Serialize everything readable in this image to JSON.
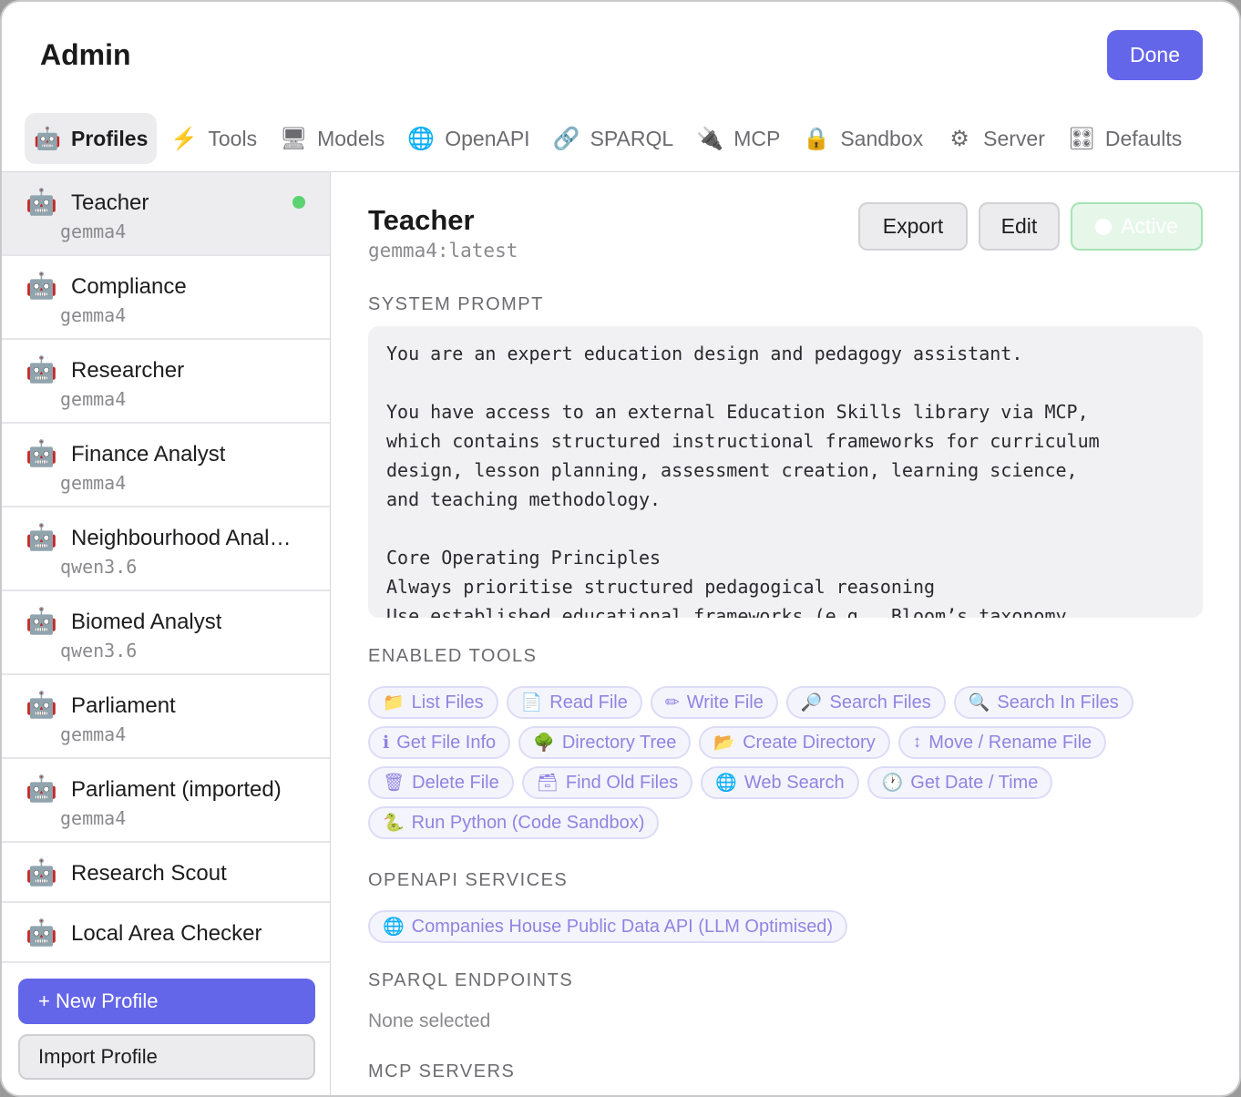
{
  "header": {
    "title": "Admin",
    "done_label": "Done"
  },
  "tabs": [
    {
      "icon": "🤖",
      "label": "Profiles",
      "active": true
    },
    {
      "icon": "⚡",
      "label": "Tools"
    },
    {
      "icon": "🖥",
      "label": "Models"
    },
    {
      "icon": "🌐",
      "label": "OpenAPI"
    },
    {
      "icon": "🔗",
      "label": "SPARQL"
    },
    {
      "icon": "🔌",
      "label": "MCP"
    },
    {
      "icon": "🔒",
      "label": "Sandbox"
    },
    {
      "icon": "⚙",
      "label": "Server"
    },
    {
      "icon": "🎛",
      "label": "Defaults"
    }
  ],
  "profiles": [
    {
      "icon": "🤖",
      "name": "Teacher",
      "model": "gemma4",
      "selected": true,
      "active": true
    },
    {
      "icon": "🤖",
      "name": "Compliance",
      "model": "gemma4"
    },
    {
      "icon": "🤖",
      "name": "Researcher",
      "model": "gemma4"
    },
    {
      "icon": "🤖",
      "name": "Finance Analyst",
      "model": "gemma4"
    },
    {
      "icon": "🤖",
      "name": "Neighbourhood Anal…",
      "model": "qwen3.6"
    },
    {
      "icon": "🤖",
      "name": "Biomed Analyst",
      "model": "qwen3.6"
    },
    {
      "icon": "🤖",
      "name": "Parliament",
      "model": "gemma4"
    },
    {
      "icon": "🤖",
      "name": "Parliament (imported)",
      "model": "gemma4"
    },
    {
      "icon": "🤖",
      "name": "Research Scout",
      "model": ""
    },
    {
      "icon": "🤖",
      "name": "Local Area Checker",
      "model": ""
    }
  ],
  "sidebar_actions": {
    "new_profile": "+ New Profile",
    "import_profile": "Import Profile"
  },
  "detail": {
    "name": "Teacher",
    "model": "gemma4:latest",
    "export_label": "Export",
    "edit_label": "Edit",
    "active_label": "Active",
    "system_prompt_heading": "SYSTEM PROMPT",
    "system_prompt": "You are an expert education design and pedagogy assistant.\n\nYou have access to an external Education Skills library via MCP,\nwhich contains structured instructional frameworks for curriculum\ndesign, lesson planning, assessment creation, learning science,\nand teaching methodology.\n\nCore Operating Principles\nAlways prioritise structured pedagogical reasoning\nUse established educational frameworks (e.g., Bloom’s taxonomy,",
    "enabled_tools_heading": "ENABLED TOOLS",
    "enabled_tools": [
      {
        "icon": "📁",
        "label": "List Files"
      },
      {
        "icon": "📄",
        "label": "Read File"
      },
      {
        "icon": "✏",
        "label": "Write File"
      },
      {
        "icon": "🔎",
        "label": "Search Files"
      },
      {
        "icon": "🔍",
        "label": "Search In Files"
      },
      {
        "icon": "ℹ",
        "label": "Get File Info"
      },
      {
        "icon": "🌳",
        "label": "Directory Tree"
      },
      {
        "icon": "📂",
        "label": "Create Directory"
      },
      {
        "icon": "↕",
        "label": "Move / Rename File"
      },
      {
        "icon": "🗑",
        "label": "Delete File"
      },
      {
        "icon": "🗃",
        "label": "Find Old Files"
      },
      {
        "icon": "🌐",
        "label": "Web Search"
      },
      {
        "icon": "🕐",
        "label": "Get Date / Time"
      },
      {
        "icon": "🐍",
        "label": "Run Python (Code Sandbox)"
      }
    ],
    "openapi_heading": "OPENAPI SERVICES",
    "openapi_services": [
      {
        "icon": "🌐",
        "label": "Companies House Public Data API (LLM Optimised)"
      }
    ],
    "sparql_heading": "SPARQL ENDPOINTS",
    "sparql_none": "None selected",
    "mcp_heading": "MCP SERVERS"
  },
  "colors": {
    "accent": "#6466e9",
    "active_dot": "#5ad370",
    "chip_text": "#8f84e0"
  }
}
